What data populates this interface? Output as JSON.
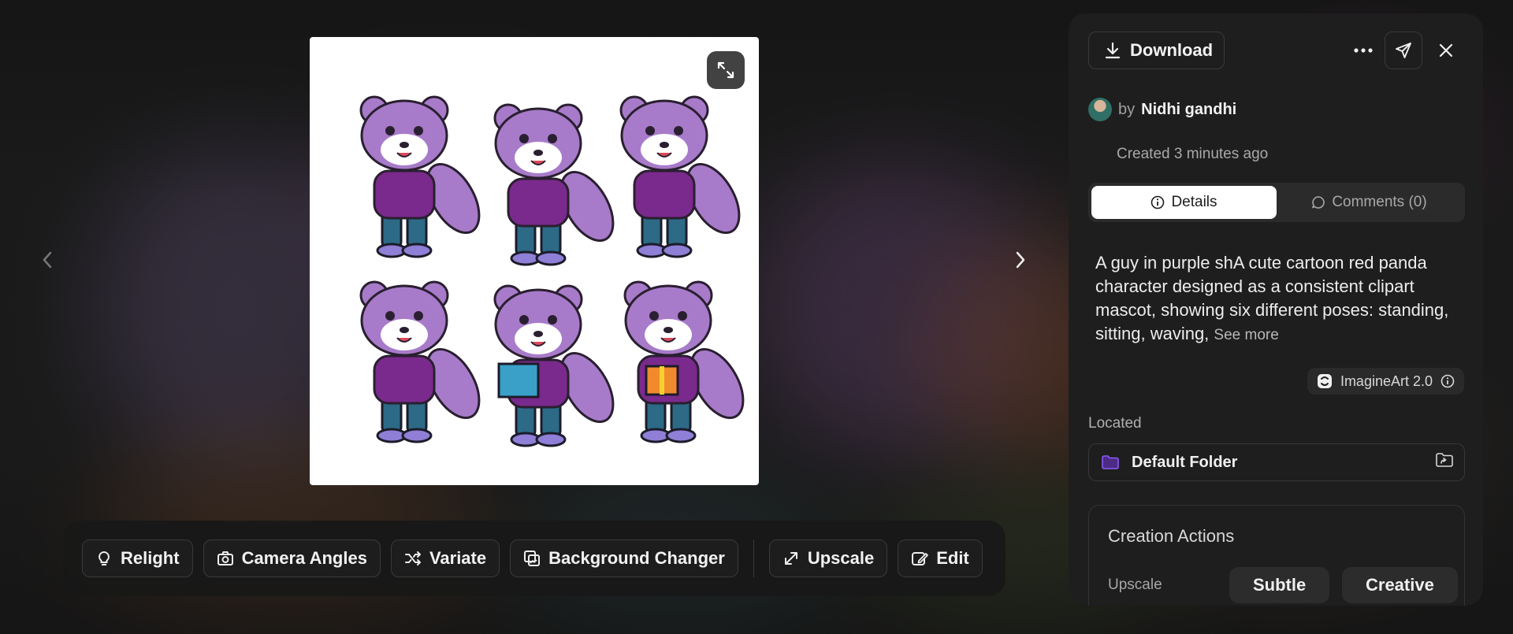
{
  "toolbar": {
    "relight_label": "Relight",
    "camera_angles_label": "Camera Angles",
    "variate_label": "Variate",
    "background_changer_label": "Background Changer",
    "upscale_label": "Upscale",
    "edit_label": "Edit"
  },
  "panel": {
    "download_label": "Download",
    "author_prefix": "by",
    "author_name": "Nidhi gandhi",
    "created": "Created 3 minutes ago",
    "tabs": [
      {
        "label": "Details",
        "active": true
      },
      {
        "label": "Comments (0)",
        "active": false
      }
    ],
    "prompt": "A guy in purple shA cute cartoon red panda character designed as a consistent clipart mascot, showing six different poses: standing, sitting, waving,",
    "see_more_label": "See more",
    "model_name": "ImagineArt 2.0",
    "located_label": "Located",
    "folder_name": "Default Folder",
    "creation_actions_title": "Creation Actions",
    "upscale_row_label": "Upscale",
    "upscale_options": [
      "Subtle",
      "Creative"
    ]
  },
  "colors": {
    "panel_bg": "#1e1e1e",
    "folder_icon": "#8b5cf6",
    "panda_fur": "#a77bc9",
    "shirt": "#7a2a8c",
    "jeans": "#2c6a86"
  },
  "icons": {
    "prev": "chevron-left-icon",
    "next": "chevron-right-icon",
    "expand": "expand-arrows-icon",
    "download": "download-icon",
    "more": "ellipsis-icon",
    "share": "send-icon",
    "close": "close-icon"
  }
}
